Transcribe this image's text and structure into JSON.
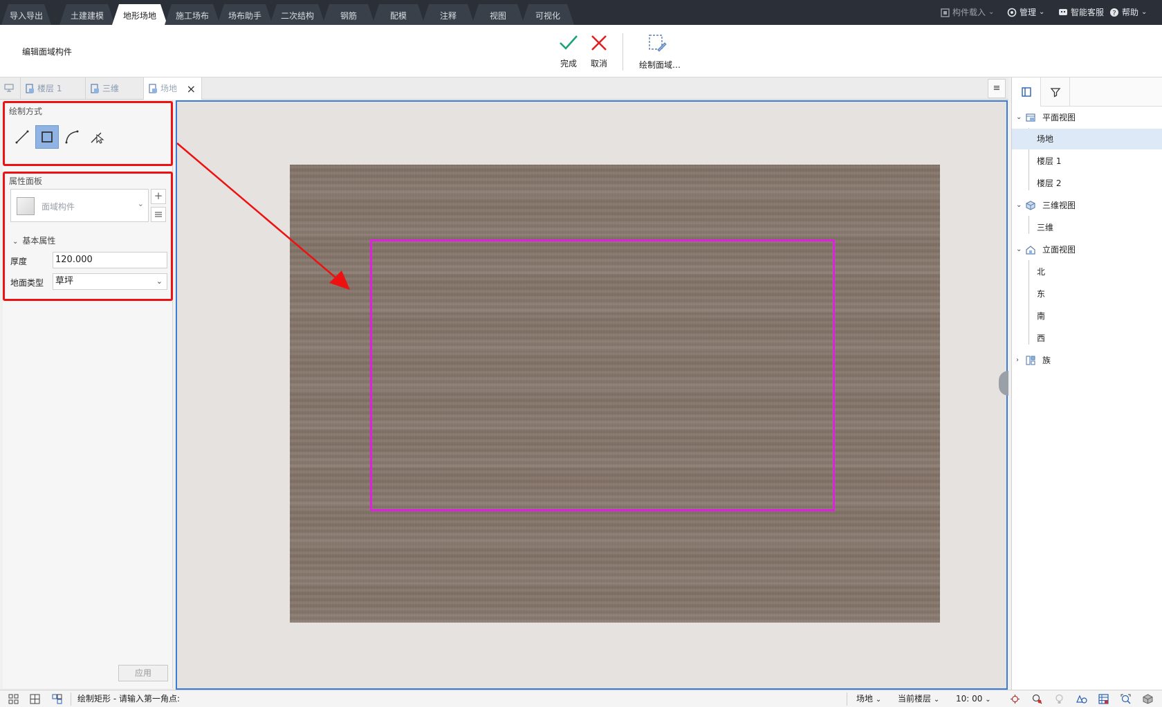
{
  "menubar": {
    "tabs": [
      "导入导出",
      "土建建模",
      "地形场地",
      "施工场布",
      "场布助手",
      "二次结构",
      "钢筋",
      "配模",
      "注释",
      "视图",
      "可视化"
    ],
    "active_tab": "地形场地",
    "right": {
      "component_load": "构件载入",
      "manage": "管理",
      "service": "智能客服",
      "help": "帮助"
    }
  },
  "ribbon": {
    "title": "编辑面域构件",
    "finish_label": "完成",
    "cancel_label": "取消",
    "draw_area_label": "绘制面域…",
    "colors": {
      "finish": "#1aa37a",
      "cancel": "#e02020"
    }
  },
  "doc_tabs": {
    "tabs": [
      {
        "label": "楼层 1"
      },
      {
        "label": "三维"
      },
      {
        "label": "场地"
      }
    ],
    "menu_icon": "≡"
  },
  "left_panel": {
    "draw_mode_title": "绘制方式",
    "tools": [
      "line-tool-icon",
      "rectangle-tool-icon",
      "arc-tool-icon",
      "pick-tool-icon"
    ],
    "selected_tool": "rectangle-tool-icon",
    "property_panel_title": "属性面板",
    "component_type_placeholder": "面域构件",
    "basic_props_title": "基本属性",
    "thickness_label": "厚度",
    "thickness_value": "120.000",
    "ground_type_label": "地面类型",
    "ground_type_value": "草坪",
    "apply_label": "应用"
  },
  "canvas": {
    "terrain_color": "#86766b",
    "selection_color": "#e020e0",
    "annotation_color": "#ee1111"
  },
  "tree": {
    "plan_view": "平面视图",
    "plan_items": [
      "场地",
      "楼层 1",
      "楼层 2"
    ],
    "selected_item": "场地",
    "view_3d": "三维视图",
    "view_3d_items": [
      "三维"
    ],
    "elevation_view": "立面视图",
    "elevation_items": [
      "北",
      "东",
      "南",
      "西"
    ],
    "family": "族"
  },
  "statusbar": {
    "message": "绘制矩形 - 请输入第一角点:",
    "site": "场地",
    "current_floor": "当前楼层",
    "scale": "10: 00"
  }
}
